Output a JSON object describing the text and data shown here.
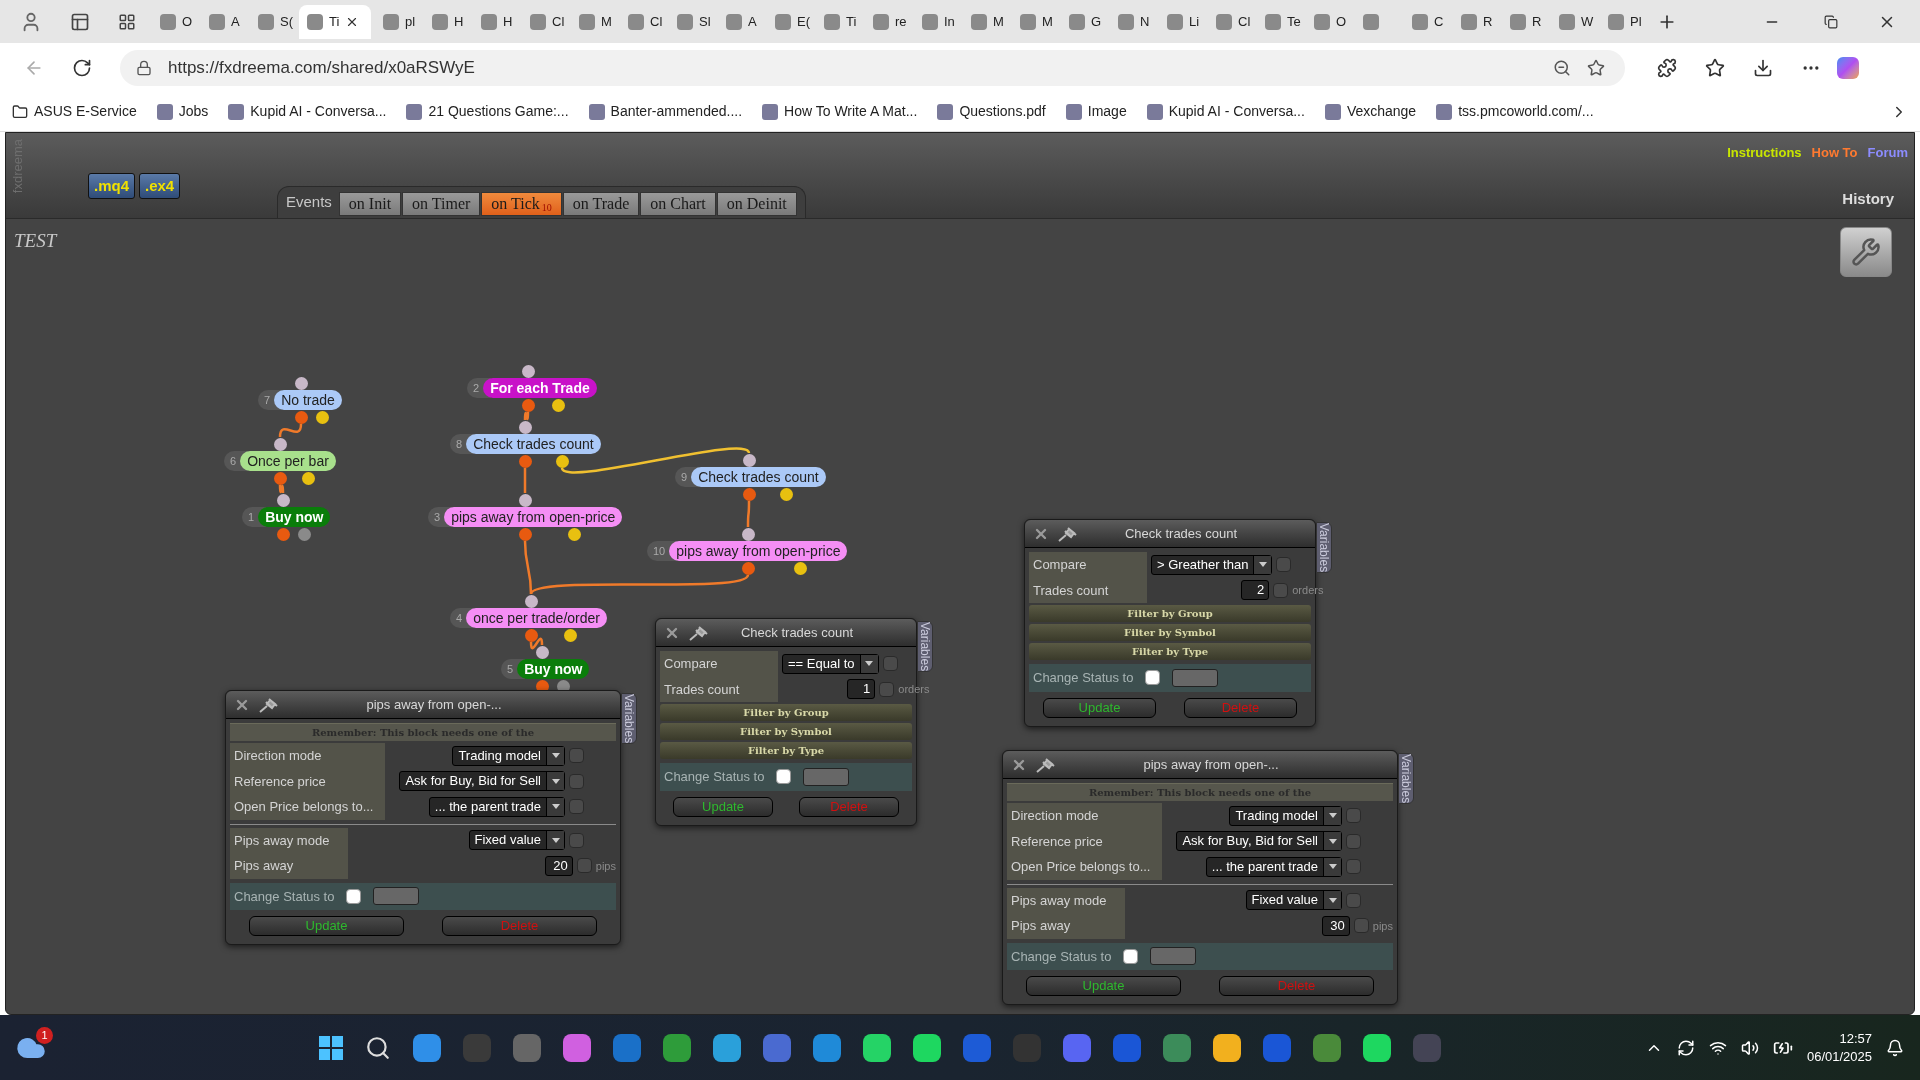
{
  "browser": {
    "tabs": [
      {
        "title": "O",
        "selected": false
      },
      {
        "title": "A",
        "selected": false
      },
      {
        "title": "S(",
        "selected": false
      },
      {
        "title": "Ti",
        "selected": true
      },
      {
        "title": "pl",
        "selected": false
      },
      {
        "title": "H",
        "selected": false
      },
      {
        "title": "H",
        "selected": false
      },
      {
        "title": "Cl",
        "selected": false
      },
      {
        "title": "M",
        "selected": false
      },
      {
        "title": "Cl",
        "selected": false
      },
      {
        "title": "Sl",
        "selected": false
      },
      {
        "title": "A",
        "selected": false
      },
      {
        "title": "E(",
        "selected": false
      },
      {
        "title": "Ti",
        "selected": false
      },
      {
        "title": "re",
        "selected": false
      },
      {
        "title": "In",
        "selected": false
      },
      {
        "title": "M",
        "selected": false
      },
      {
        "title": "M",
        "selected": false
      },
      {
        "title": "G",
        "selected": false
      },
      {
        "title": "N",
        "selected": false
      },
      {
        "title": "Li",
        "selected": false
      },
      {
        "title": "Cl",
        "selected": false
      },
      {
        "title": "Te",
        "selected": false
      },
      {
        "title": "O",
        "selected": false
      },
      {
        "selected": false
      },
      {
        "title": "C",
        "selected": false
      },
      {
        "title": "R",
        "selected": false
      },
      {
        "title": "R",
        "selected": false
      },
      {
        "title": "W",
        "selected": false
      },
      {
        "title": "Pl",
        "selected": false
      }
    ],
    "address": "https://fxdreema.com/shared/x0aRSWyE",
    "bookmarks": [
      "ASUS E-Service",
      "Jobs",
      "Kupid AI - Conversa...",
      "21 Questions Game:...",
      "Banter-ammended....",
      "How To Write A Mat...",
      "Questions.pdf",
      "Image",
      "Kupid AI - Conversa...",
      "Vexchange",
      "tss.pmcoworld.com/..."
    ]
  },
  "app": {
    "brand": "fxdreema",
    "exports": [
      ".mq4",
      ".ex4"
    ],
    "events_label": "Events",
    "tabs": [
      {
        "label": "on Init",
        "selected": false
      },
      {
        "label": "on Timer",
        "selected": false
      },
      {
        "label": "on Tick",
        "badge": "10",
        "selected": true
      },
      {
        "label": "on Trade",
        "selected": false
      },
      {
        "label": "on Chart",
        "selected": false
      },
      {
        "label": "on Deinit",
        "selected": false
      }
    ],
    "links": [
      {
        "label": "Instructions",
        "color": "#c8e600"
      },
      {
        "label": "How To",
        "color": "#ff7a30"
      },
      {
        "label": "Forum",
        "color": "#8c8cff"
      }
    ],
    "history": "History",
    "project": "TEST"
  },
  "nodes": [
    {
      "number": "7",
      "label": "No trade",
      "kind": "condition",
      "color": "#abc9f7"
    },
    {
      "number": "6",
      "label": "Once per bar",
      "kind": "condition",
      "color": "#a8e08c"
    },
    {
      "number": "1",
      "label": "Buy now",
      "kind": "action",
      "color": "#0a7d0a"
    },
    {
      "number": "2",
      "label": "For each Trade",
      "kind": "loop",
      "color": "#c812c8"
    },
    {
      "number": "8",
      "label": "Check trades count",
      "kind": "condition",
      "color": "#abc9f7"
    },
    {
      "number": "9",
      "label": "Check trades count",
      "kind": "condition",
      "color": "#abc9f7"
    },
    {
      "number": "3",
      "label": "pips away from open-price",
      "kind": "condition",
      "color": "#f58ef5"
    },
    {
      "number": "10",
      "label": "pips away from open-price",
      "kind": "condition",
      "color": "#f58ef5"
    },
    {
      "number": "4",
      "label": "once per trade/order",
      "kind": "condition",
      "color": "#f58ef5"
    },
    {
      "number": "5",
      "label": "Buy now",
      "kind": "action",
      "color": "#0a7d0a"
    }
  ],
  "panels": [
    {
      "title": "Check trades count",
      "sections": [
        {
          "rows": [
            {
              "label": "Compare",
              "kind": "select",
              "value": "> Greather than",
              "checked": false
            },
            {
              "label": "Trades count",
              "kind": "number",
              "value": "2",
              "checked": false,
              "unit": "orders"
            }
          ]
        }
      ],
      "filters": [
        "Filter by Group",
        "Filter by Symbol",
        "Filter by Type"
      ],
      "status_label": "Change Status to",
      "status_checked": false,
      "buttons": [
        {
          "label": "Update",
          "kind": "update"
        },
        {
          "label": "Delete",
          "kind": "delete"
        }
      ],
      "side_tab": "Variables"
    },
    {
      "title": "Check trades count",
      "sections": [
        {
          "rows": [
            {
              "label": "Compare",
              "kind": "select",
              "value": "== Equal to",
              "checked": false
            },
            {
              "label": "Trades count",
              "kind": "number",
              "value": "1",
              "checked": false,
              "unit": "orders"
            }
          ]
        }
      ],
      "filters": [
        "Filter by Group",
        "Filter by Symbol",
        "Filter by Type"
      ],
      "status_label": "Change Status to",
      "status_checked": false,
      "buttons": [
        {
          "label": "Update",
          "kind": "update"
        },
        {
          "label": "Delete",
          "kind": "delete"
        }
      ],
      "side_tab": "Variables"
    },
    {
      "title": "pips away from open-...",
      "notice": "Remember: This block needs one of the",
      "sections": [
        {
          "rows": [
            {
              "label": "Direction mode",
              "kind": "select",
              "value": "Trading model",
              "checked": false
            },
            {
              "label": "Reference price",
              "kind": "select",
              "value": "Ask for Buy, Bid for Sell",
              "checked": false
            },
            {
              "label": "Open Price belongs to...",
              "kind": "select",
              "value": "... the parent trade",
              "checked": false
            }
          ]
        },
        {
          "rows": [
            {
              "label": "Pips away mode",
              "kind": "select",
              "value": "Fixed value",
              "checked": false
            },
            {
              "label": "Pips away",
              "kind": "number",
              "value": "20",
              "checked": false,
              "unit": "pips"
            }
          ]
        }
      ],
      "status_label": "Change Status to",
      "status_checked": false,
      "buttons": [
        {
          "label": "Update",
          "kind": "update"
        },
        {
          "label": "Delete",
          "kind": "delete"
        }
      ],
      "side_tab": "Variables"
    },
    {
      "title": "pips away from open-...",
      "notice": "Remember: This block needs one of the",
      "sections": [
        {
          "rows": [
            {
              "label": "Direction mode",
              "kind": "select",
              "value": "Trading model",
              "checked": false
            },
            {
              "label": "Reference price",
              "kind": "select",
              "value": "Ask for Buy, Bid for Sell",
              "checked": false
            },
            {
              "label": "Open Price belongs to...",
              "kind": "select",
              "value": "... the parent trade",
              "checked": false
            }
          ]
        },
        {
          "rows": [
            {
              "label": "Pips away mode",
              "kind": "select",
              "value": "Fixed value",
              "checked": false
            },
            {
              "label": "Pips away",
              "kind": "number",
              "value": "30",
              "checked": false,
              "unit": "pips"
            }
          ]
        }
      ],
      "status_label": "Change Status to",
      "status_checked": false,
      "buttons": [
        {
          "label": "Update",
          "kind": "update"
        },
        {
          "label": "Delete",
          "kind": "delete"
        }
      ],
      "side_tab": "Variables"
    }
  ],
  "taskbar": {
    "notification_count": "1",
    "time": "12:57",
    "date": "06/01/2025"
  }
}
